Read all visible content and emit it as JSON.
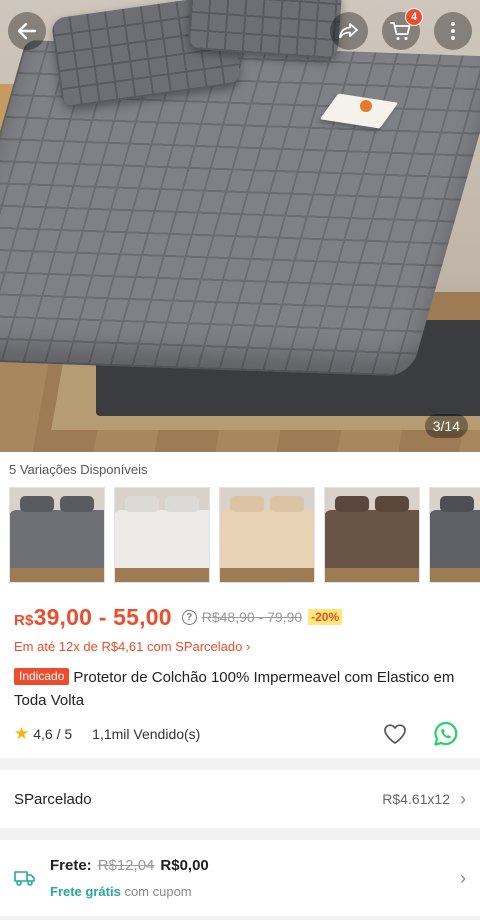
{
  "gallery": {
    "counter": "3/14",
    "cart_count": "4"
  },
  "icons": {
    "back": "back-arrow-icon",
    "share": "share-icon",
    "cart": "cart-icon",
    "more": "more-vertical-icon",
    "star": "star-icon",
    "like": "heart-icon",
    "whatsapp": "whatsapp-icon",
    "truck": "truck-icon",
    "chevron": "chevron-right-icon"
  },
  "variations": {
    "title": "5 Variações Disponíveis",
    "items": [
      {
        "color": "#6e6f74"
      },
      {
        "color": "#eceae6"
      },
      {
        "color": "#e8d2b6"
      },
      {
        "color": "#6a5446"
      },
      {
        "color": "#5f6066"
      }
    ]
  },
  "price": {
    "currency": "R$",
    "range": "39,00 - 55,00",
    "old": "R$48,90 - 79,90",
    "discount": "-20%",
    "installments": "Em até 12x de R$4,61 com SParcelado ›"
  },
  "product": {
    "badge": "Indicado",
    "title": "Protetor de Colchão 100% Impermeavel com Elastico em Toda Volta",
    "rating": "4,6 / 5",
    "sold": "1,1mil Vendido(s)"
  },
  "sparcelado": {
    "label": "SParcelado",
    "value": "R$4.61x12"
  },
  "shipping": {
    "label": "Frete:",
    "old_price": "R$12,04",
    "price": "R$0,00",
    "free_label": "Frete grátis",
    "free_suffix": "com cupom"
  },
  "colors": {
    "accent": "#ee4d2d",
    "green": "#26aa99",
    "whatsapp": "#25d366",
    "star": "#f5b50a"
  }
}
